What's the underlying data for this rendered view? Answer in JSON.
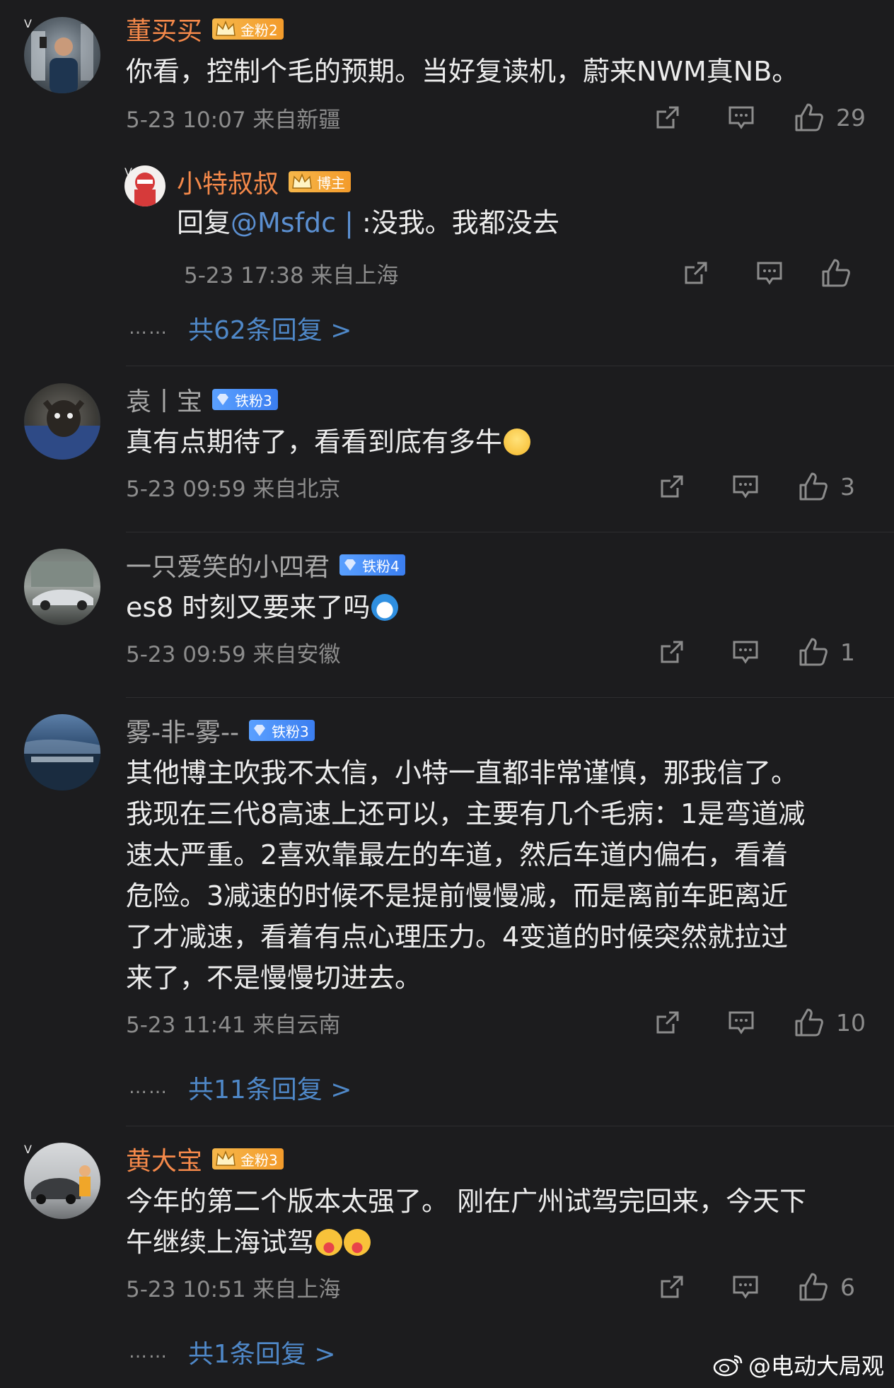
{
  "comments": [
    {
      "name": "董买买",
      "badge": "金粉2",
      "text": "你看，控制个毛的预期。当好复读机，蔚来NWM真NB。",
      "time": "5-23 10:07 来自新疆",
      "likes": "29",
      "reply": {
        "name": "小特叔叔",
        "badge": "博主",
        "prefix": "回复",
        "mention": "@Msfdc",
        "sep": "|",
        "text": ":没我。我都没去",
        "time": "5-23 17:38 来自上海"
      },
      "more": "共62条回复 >"
    },
    {
      "name": "袁丨宝",
      "badge": "铁粉3",
      "text": "真有点期待了，看看到底有多牛",
      "time": "5-23 09:59 来自北京",
      "likes": "3"
    },
    {
      "name": "一只爱笑的小四君",
      "badge": "铁粉4",
      "text": "es8 时刻又要来了吗",
      "time": "5-23 09:59 来自安徽",
      "likes": "1"
    },
    {
      "name": "雾-非-雾--",
      "badge": "铁粉3",
      "lines": [
        "其他博主吹我不太信，小特一直都非常谨慎，那我信了。",
        "我现在三代8高速上还可以，主要有几个毛病：1是弯道减",
        "速太严重。2喜欢靠最左的车道，然后车道内偏右，看着",
        "危险。3减速的时候不是提前慢慢减，而是离前车距离近",
        "了才减速，看着有点心理压力。4变道的时候突然就拉过",
        "来了，不是慢慢切进去。"
      ],
      "time": "5-23 11:41 来自云南",
      "likes": "10",
      "more": "共11条回复 >"
    },
    {
      "name": "黄大宝",
      "badge": "金粉3",
      "lines": [
        "今年的第二个版本太强了。 刚在广州试驾完回来，今天下",
        "午继续上海试驾"
      ],
      "time": "5-23 10:51 来自上海",
      "likes": "6",
      "more": "共1条回复 >"
    }
  ],
  "dots": "……",
  "watermark": "@电动大局观",
  "colors": {
    "background": "#1c1c1e",
    "gold_name": "#f5894a",
    "link": "#4f88c8",
    "meta": "#8c8c8c"
  },
  "icons": [
    "share-icon",
    "comment-icon",
    "like-icon",
    "weibo-logo-icon"
  ]
}
